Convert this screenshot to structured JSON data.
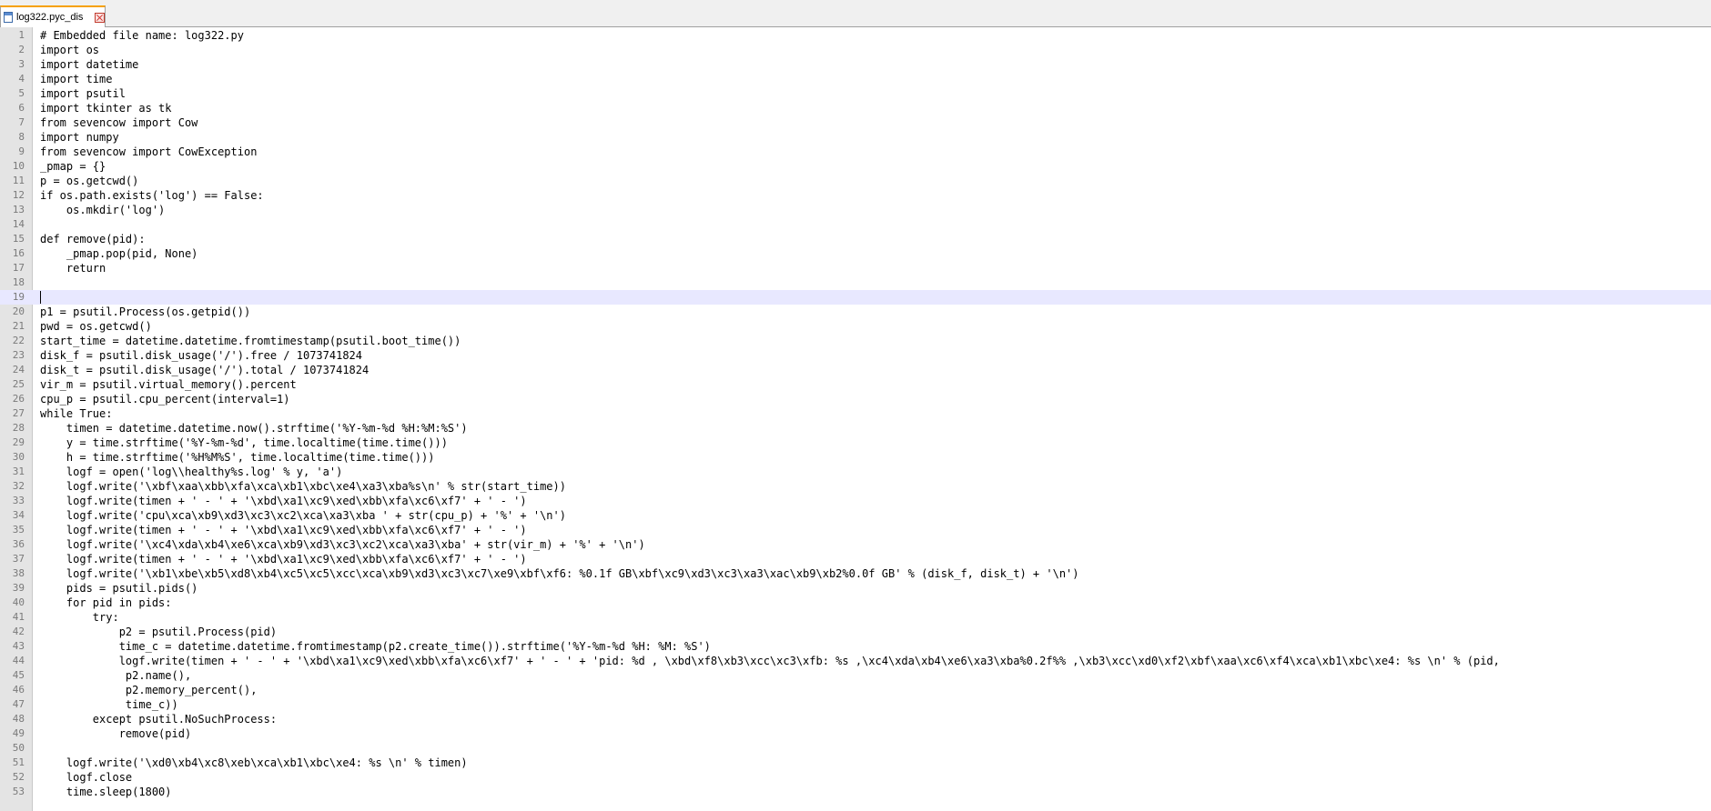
{
  "tab": {
    "title": "log322.pyc_dis"
  },
  "editor": {
    "current_line": 19,
    "lines": [
      {
        "n": "1",
        "text": "# Embedded file name: log322.py"
      },
      {
        "n": "2",
        "text": "import os"
      },
      {
        "n": "3",
        "text": "import datetime"
      },
      {
        "n": "4",
        "text": "import time"
      },
      {
        "n": "5",
        "text": "import psutil"
      },
      {
        "n": "6",
        "text": "import tkinter as tk"
      },
      {
        "n": "7",
        "text": "from sevencow import Cow"
      },
      {
        "n": "8",
        "text": "import numpy"
      },
      {
        "n": "9",
        "text": "from sevencow import CowException"
      },
      {
        "n": "10",
        "text": "_pmap = {}"
      },
      {
        "n": "11",
        "text": "p = os.getcwd()"
      },
      {
        "n": "12",
        "text": "if os.path.exists('log') == False:"
      },
      {
        "n": "13",
        "text": "    os.mkdir('log')"
      },
      {
        "n": "14",
        "text": ""
      },
      {
        "n": "15",
        "text": "def remove(pid):"
      },
      {
        "n": "16",
        "text": "    _pmap.pop(pid, None)"
      },
      {
        "n": "17",
        "text": "    return"
      },
      {
        "n": "18",
        "text": ""
      },
      {
        "n": "19",
        "text": ""
      },
      {
        "n": "20",
        "text": "p1 = psutil.Process(os.getpid())"
      },
      {
        "n": "21",
        "text": "pwd = os.getcwd()"
      },
      {
        "n": "22",
        "text": "start_time = datetime.datetime.fromtimestamp(psutil.boot_time())"
      },
      {
        "n": "23",
        "text": "disk_f = psutil.disk_usage('/').free / 1073741824"
      },
      {
        "n": "24",
        "text": "disk_t = psutil.disk_usage('/').total / 1073741824"
      },
      {
        "n": "25",
        "text": "vir_m = psutil.virtual_memory().percent"
      },
      {
        "n": "26",
        "text": "cpu_p = psutil.cpu_percent(interval=1)"
      },
      {
        "n": "27",
        "text": "while True:"
      },
      {
        "n": "28",
        "text": "    timen = datetime.datetime.now().strftime('%Y-%m-%d %H:%M:%S')"
      },
      {
        "n": "29",
        "text": "    y = time.strftime('%Y-%m-%d', time.localtime(time.time()))"
      },
      {
        "n": "30",
        "text": "    h = time.strftime('%H%M%S', time.localtime(time.time()))"
      },
      {
        "n": "31",
        "text": "    logf = open('log\\\\healthy%s.log' % y, 'a')"
      },
      {
        "n": "32",
        "text": "    logf.write('\\xbf\\xaa\\xbb\\xfa\\xca\\xb1\\xbc\\xe4\\xa3\\xba%s\\n' % str(start_time))"
      },
      {
        "n": "33",
        "text": "    logf.write(timen + ' - ' + '\\xbd\\xa1\\xc9\\xed\\xbb\\xfa\\xc6\\xf7' + ' - ')"
      },
      {
        "n": "34",
        "text": "    logf.write('cpu\\xca\\xb9\\xd3\\xc3\\xc2\\xca\\xa3\\xba ' + str(cpu_p) + '%' + '\\n')"
      },
      {
        "n": "35",
        "text": "    logf.write(timen + ' - ' + '\\xbd\\xa1\\xc9\\xed\\xbb\\xfa\\xc6\\xf7' + ' - ')"
      },
      {
        "n": "36",
        "text": "    logf.write('\\xc4\\xda\\xb4\\xe6\\xca\\xb9\\xd3\\xc3\\xc2\\xca\\xa3\\xba' + str(vir_m) + '%' + '\\n')"
      },
      {
        "n": "37",
        "text": "    logf.write(timen + ' - ' + '\\xbd\\xa1\\xc9\\xed\\xbb\\xfa\\xc6\\xf7' + ' - ')"
      },
      {
        "n": "38",
        "text": "    logf.write('\\xb1\\xbe\\xb5\\xd8\\xb4\\xc5\\xc5\\xcc\\xca\\xb9\\xd3\\xc3\\xc7\\xe9\\xbf\\xf6: %0.1f GB\\xbf\\xc9\\xd3\\xc3\\xa3\\xac\\xb9\\xb2%0.0f GB' % (disk_f, disk_t) + '\\n')"
      },
      {
        "n": "39",
        "text": "    pids = psutil.pids()"
      },
      {
        "n": "40",
        "text": "    for pid in pids:"
      },
      {
        "n": "41",
        "text": "        try:"
      },
      {
        "n": "42",
        "text": "            p2 = psutil.Process(pid)"
      },
      {
        "n": "43",
        "text": "            time_c = datetime.datetime.fromtimestamp(p2.create_time()).strftime('%Y-%m-%d %H: %M: %S')"
      },
      {
        "n": "44",
        "text": "            logf.write(timen + ' - ' + '\\xbd\\xa1\\xc9\\xed\\xbb\\xfa\\xc6\\xf7' + ' - ' + 'pid: %d , \\xbd\\xf8\\xb3\\xcc\\xc3\\xfb: %s ,\\xc4\\xda\\xb4\\xe6\\xa3\\xba%0.2f%% ,\\xb3\\xcc\\xd0\\xf2\\xbf\\xaa\\xc6\\xf4\\xca\\xb1\\xbc\\xe4: %s \\n' % (pid,"
      },
      {
        "n": "45",
        "text": "             p2.name(),"
      },
      {
        "n": "46",
        "text": "             p2.memory_percent(),"
      },
      {
        "n": "47",
        "text": "             time_c))"
      },
      {
        "n": "48",
        "text": "        except psutil.NoSuchProcess:"
      },
      {
        "n": "49",
        "text": "            remove(pid)"
      },
      {
        "n": "50",
        "text": ""
      },
      {
        "n": "51",
        "text": "    logf.write('\\xd0\\xb4\\xc8\\xeb\\xca\\xb1\\xbc\\xe4: %s \\n' % timen)"
      },
      {
        "n": "52",
        "text": "    logf.close"
      },
      {
        "n": "53",
        "text": "    time.sleep(1800)"
      }
    ]
  }
}
